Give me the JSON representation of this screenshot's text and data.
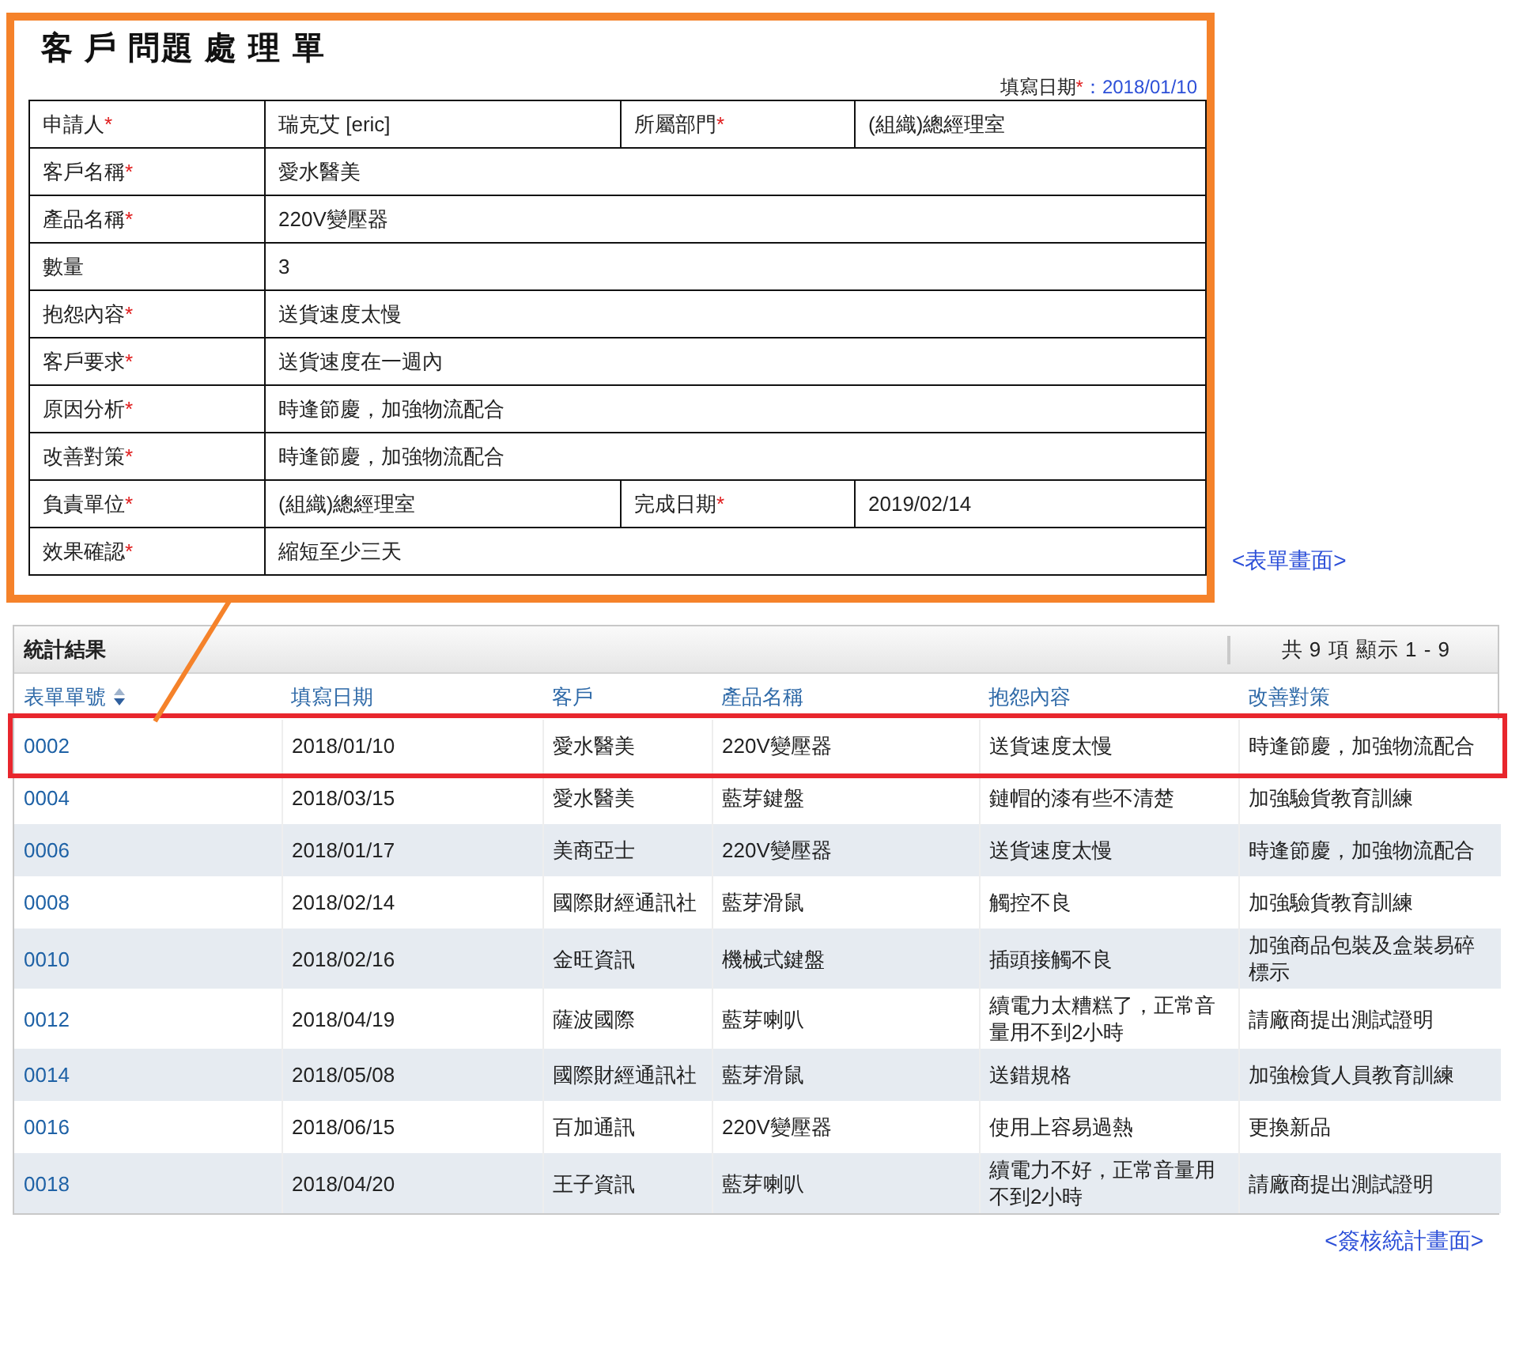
{
  "form": {
    "title": "客 戶 問題 處 理 單",
    "fill_date": {
      "label": "填寫日期",
      "mark": "*",
      "value": "：2018/01/10"
    },
    "rows": [
      [
        {
          "label": "申請人",
          "mark": "*",
          "value": "瑞克艾 [eric]"
        },
        {
          "label": "所屬部門",
          "mark": "*",
          "value": "(組織)總經理室"
        }
      ],
      [
        {
          "label": "客戶名稱",
          "mark": "*",
          "value": "愛水醫美"
        }
      ],
      [
        {
          "label": "產品名稱",
          "mark": "*",
          "value": "220V變壓器"
        }
      ],
      [
        {
          "label": "數量",
          "value": "3"
        }
      ],
      [
        {
          "label": "抱怨內容",
          "mark": "*",
          "value": "送貨速度太慢"
        }
      ],
      [
        {
          "label": "客戶要求",
          "mark": "*",
          "value": "送貨速度在一週內"
        }
      ],
      [
        {
          "label": "原因分析",
          "mark": "*",
          "value": "時逢節慶，加強物流配合"
        }
      ],
      [
        {
          "label": "改善對策",
          "mark": "*",
          "value": "時逢節慶，加強物流配合"
        }
      ],
      [
        {
          "label": "負責單位",
          "mark": "*",
          "value": "(組織)總經理室"
        },
        {
          "label": "完成日期",
          "mark": "*",
          "value": "2019/02/14"
        }
      ],
      [
        {
          "label": "效果確認",
          "mark": "*",
          "value": "縮短至少三天"
        }
      ]
    ]
  },
  "form_link": "<表單畫面>",
  "results": {
    "title": "統計結果",
    "count": "共 9 項 顯示 1 - 9",
    "columns": [
      {
        "label": "表單單號",
        "sorted": true
      },
      {
        "label": "填寫日期",
        "sorted": false
      },
      {
        "label": "客戶",
        "sorted": false
      },
      {
        "label": "產品名稱",
        "sorted": false
      },
      {
        "label": "抱怨內容",
        "sorted": false
      },
      {
        "label": "改善對策",
        "sorted": false
      }
    ],
    "rows": [
      {
        "selected": true,
        "cells": [
          "0002",
          "2018/01/10",
          "愛水醫美",
          "220V變壓器",
          "送貨速度太慢",
          "時逢節慶，加強物流配合"
        ]
      },
      {
        "selected": false,
        "cells": [
          "0004",
          "2018/03/15",
          "愛水醫美",
          "藍芽鍵盤",
          "鏈帽的漆有些不清楚",
          "加強驗貨教育訓練"
        ]
      },
      {
        "selected": false,
        "cells": [
          "0006",
          "2018/01/17",
          "美商亞士",
          "220V變壓器",
          "送貨速度太慢",
          "時逢節慶，加強物流配合"
        ]
      },
      {
        "selected": false,
        "cells": [
          "0008",
          "2018/02/14",
          "國際財經通訊社",
          "藍芽滑鼠",
          "觸控不良",
          "加強驗貨教育訓練"
        ]
      },
      {
        "selected": false,
        "cells": [
          "0010",
          "2018/02/16",
          "金旺資訊",
          "機械式鍵盤",
          "插頭接觸不良",
          "加強商品包裝及盒裝易碎標示"
        ]
      },
      {
        "selected": false,
        "cells": [
          "0012",
          "2018/04/19",
          "薩波國際",
          "藍芽喇叭",
          "續電力太糟糕了，正常音量用不到2小時",
          "請廠商提出測試證明"
        ]
      },
      {
        "selected": false,
        "cells": [
          "0014",
          "2018/05/08",
          "國際財經通訊社",
          "藍芽滑鼠",
          "送錯規格",
          "加強檢貨人員教育訓練"
        ]
      },
      {
        "selected": false,
        "cells": [
          "0016",
          "2018/06/15",
          "百加通訊",
          "220V變壓器",
          "使用上容易過熱",
          "更換新品"
        ]
      },
      {
        "selected": false,
        "cells": [
          "0018",
          "2018/04/20",
          "王子資訊",
          "藍芽喇叭",
          "續電力不好，正常音量用不到2小時",
          "請廠商提出測試證明"
        ]
      }
    ]
  },
  "results_link": "<簽核統計畫面>"
}
